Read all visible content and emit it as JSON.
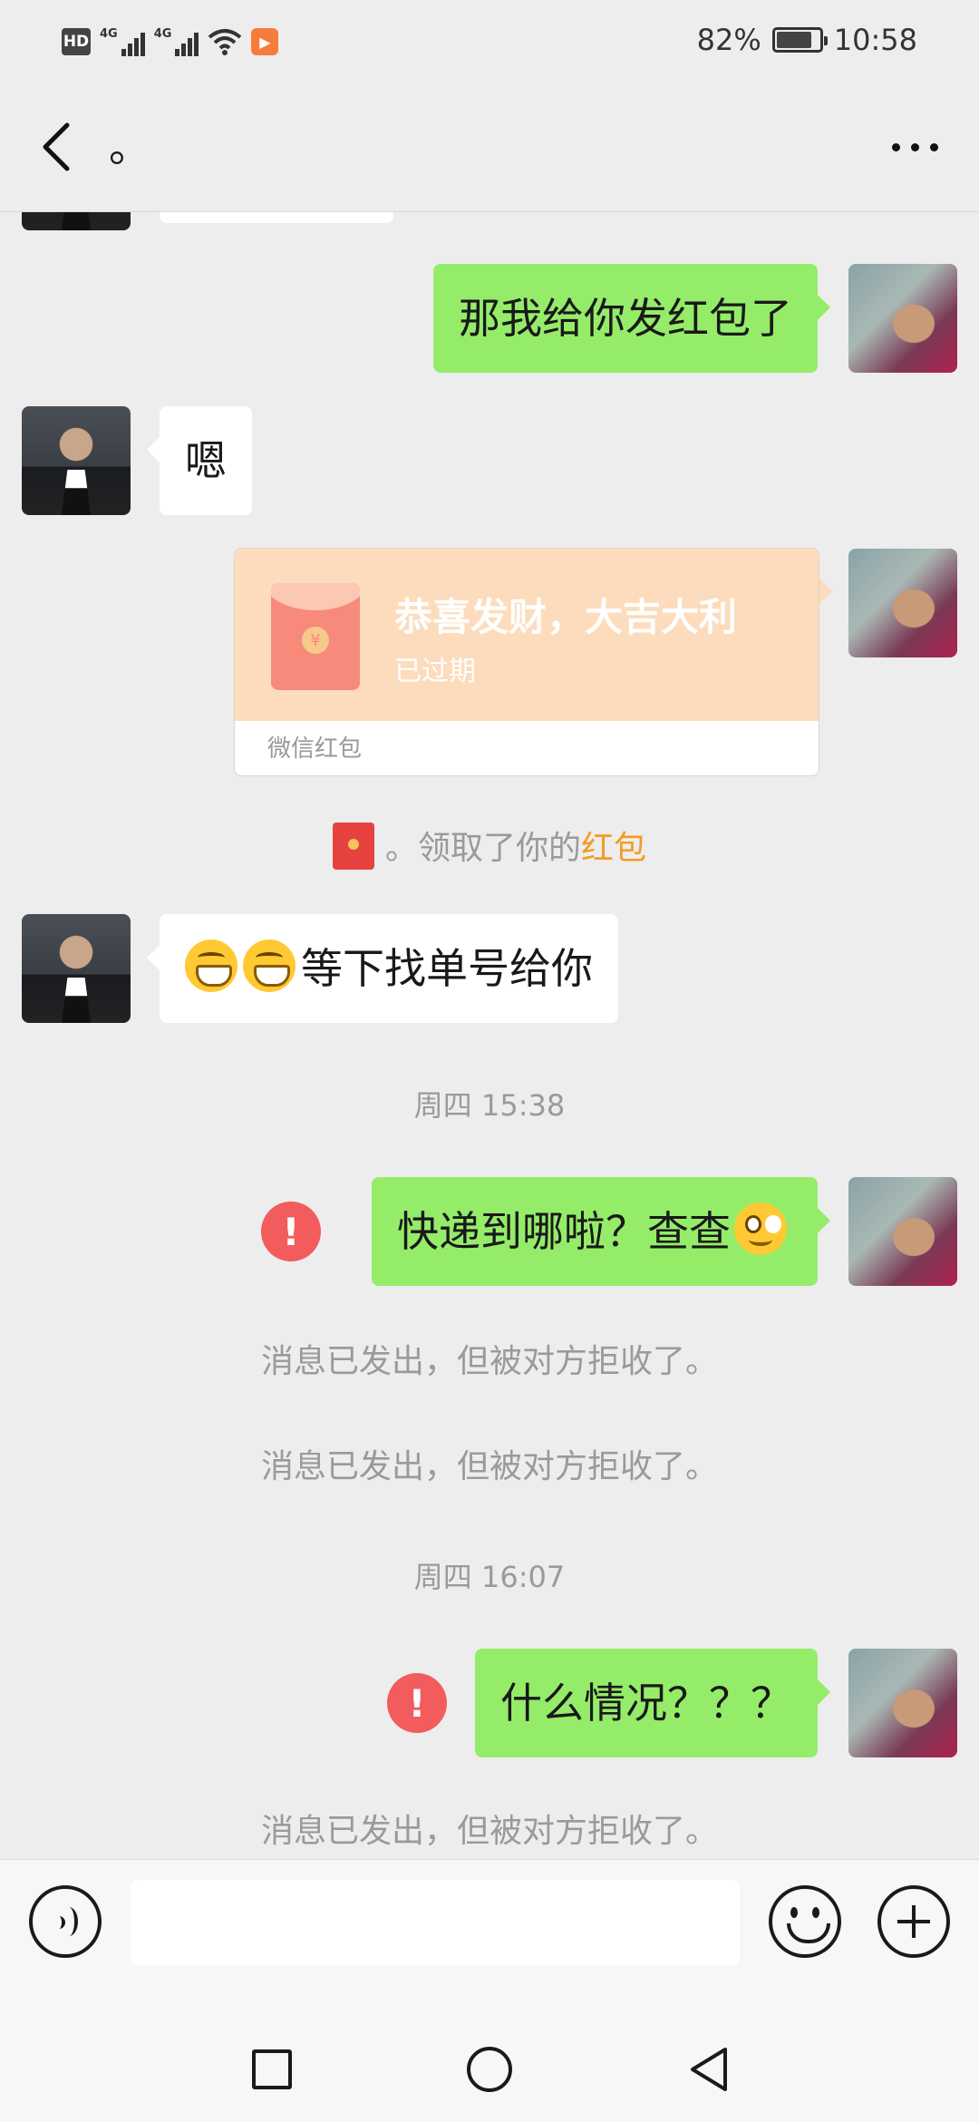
{
  "status_bar": {
    "hd_label": "HD",
    "net1": "4G",
    "net2": "4G",
    "battery_percent": "82%",
    "battery_level": 0.82,
    "time": "10:58"
  },
  "header": {
    "title": "。",
    "back_icon": "chevron-left-icon",
    "more_icon": "more-icon"
  },
  "messages": {
    "m1": "那我给你发红包了",
    "m2": "嗯",
    "red_packet": {
      "title": "恭喜发财，大吉大利",
      "status": "已过期",
      "footer": "微信红包",
      "coin": "¥"
    },
    "claim_notice": {
      "prefix": "。领取了你的",
      "link": "红包"
    },
    "m3_text": "等下找单号给你",
    "time1": "周四 15:38",
    "m4_text": "快递到哪啦？查查",
    "rejected_1": "消息已发出，但被对方拒收了。",
    "rejected_2": "消息已发出，但被对方拒收了。",
    "time2": "周四 16:07",
    "m5_text": "什么情况？？？",
    "rejected_3": "消息已发出，但被对方拒收了。",
    "error_mark": "!"
  },
  "input_bar": {
    "value": "",
    "voice_icon": "voice-icon",
    "emoji_icon": "emoji-icon",
    "plus_icon": "plus-icon"
  },
  "colors": {
    "outgoing_bubble": "#95ec69",
    "incoming_bubble": "#ffffff",
    "background": "#ededed",
    "red_packet": "#fcdcbc",
    "error": "#f25c5c",
    "highlight": "#f59a23"
  }
}
